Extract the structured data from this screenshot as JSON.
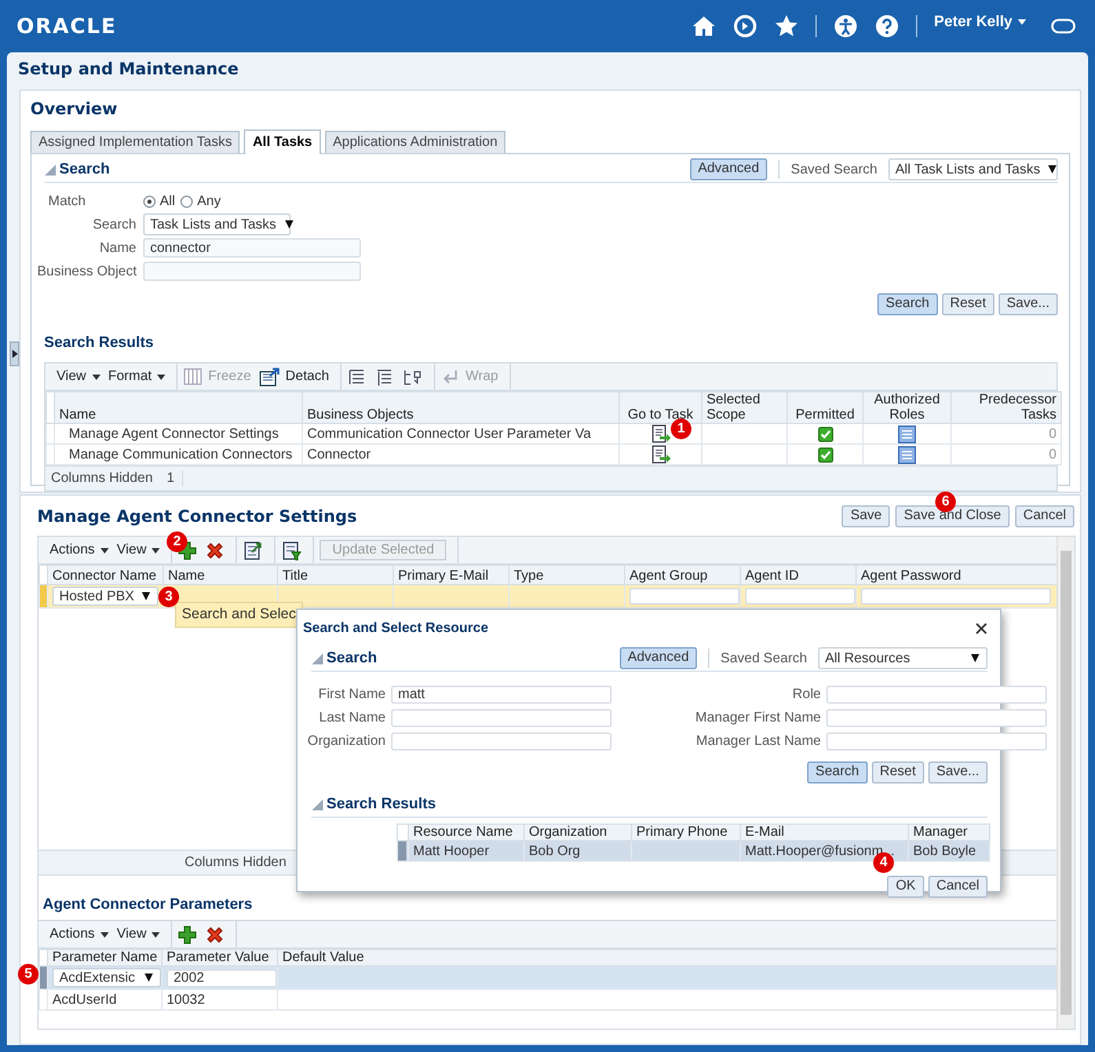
{
  "header": {
    "logo": "ORACLE",
    "user": "Peter Kelly"
  },
  "page_title": "Setup and Maintenance",
  "overview": {
    "title": "Overview",
    "tabs": [
      {
        "label": "Assigned Implementation Tasks",
        "selected": false
      },
      {
        "label": "All Tasks",
        "selected": true
      },
      {
        "label": "Applications Administration",
        "selected": false
      }
    ],
    "search": {
      "title": "Search",
      "advanced": "Advanced",
      "saved_search_label": "Saved Search",
      "saved_search": "All Task Lists and Tasks",
      "match": {
        "label": "Match",
        "options": [
          {
            "label": "All",
            "selected": true
          },
          {
            "label": "Any",
            "selected": false
          }
        ]
      },
      "fields": [
        {
          "label": "Search",
          "kind": "select",
          "value": "Task Lists and Tasks"
        },
        {
          "label": "Name",
          "kind": "text",
          "value": "connector"
        },
        {
          "label": "Business Object",
          "kind": "text"
        }
      ],
      "buttons": [
        {
          "label": "Search",
          "primary": true
        },
        {
          "label": "Reset",
          "primary": false
        },
        {
          "label": "Save...",
          "primary": false
        }
      ]
    },
    "results": {
      "title": "Search Results",
      "toolbar": [
        [
          {
            "kind": "menu",
            "label": "View",
            "disabled": false
          },
          {
            "kind": "menu",
            "label": "Format",
            "disabled": false
          }
        ],
        [
          {
            "kind": "freeze",
            "label": "Freeze",
            "disabled": true
          },
          {
            "kind": "detach",
            "label": "Detach",
            "disabled": false
          }
        ],
        [
          {
            "kind": "lines",
            "disabled": false
          },
          {
            "kind": "indent",
            "disabled": false
          },
          {
            "kind": "reorder",
            "disabled": false
          }
        ],
        [
          {
            "kind": "wrap",
            "label": "Wrap",
            "disabled": true
          }
        ]
      ],
      "columns": [
        "Name",
        "Business Objects",
        "Go to Task",
        "Selected Scope",
        "Permitted",
        "Authorized Roles",
        "Predecessor Tasks"
      ],
      "rows": [
        {
          "name": "Manage Agent Connector Settings",
          "business_objects": "Communication Connector User Parameter Va",
          "permitted": true,
          "predecessor_tasks": "0"
        },
        {
          "name": "Manage Communication Connectors",
          "business_objects": "Connector",
          "permitted": true,
          "predecessor_tasks": "0"
        }
      ],
      "columns_hidden_label": "Columns Hidden",
      "columns_hidden": "1"
    }
  },
  "settings": {
    "title": "Manage Agent Connector Settings",
    "buttons": [
      "Save",
      "Save and Close",
      "Cancel"
    ],
    "toolbar": [
      [
        {
          "kind": "menu",
          "label": "Actions",
          "disabled": false
        },
        {
          "kind": "menu",
          "label": "View",
          "disabled": false
        }
      ],
      [
        {
          "kind": "add",
          "disabled": false
        },
        {
          "kind": "delete",
          "disabled": false
        }
      ],
      [
        {
          "kind": "export",
          "disabled": false
        }
      ],
      [
        {
          "kind": "filter",
          "disabled": false
        }
      ],
      [
        {
          "kind": "text",
          "label": "Update Selected",
          "disabled": true
        }
      ]
    ],
    "columns": [
      "Connector Name",
      "Name",
      "Title",
      "Primary E-Mail",
      "Type",
      "Agent Group",
      "Agent ID",
      "Agent Password"
    ],
    "rows": [
      {
        "connector_name": "Hosted PBX",
        "selected": true
      }
    ],
    "columns_hidden_label": "Columns Hidden",
    "tooltip": "Search and Selec"
  },
  "parameters": {
    "title": "Agent Connector Parameters",
    "toolbar": [
      [
        {
          "kind": "menu",
          "label": "Actions",
          "disabled": false
        },
        {
          "kind": "menu",
          "label": "View",
          "disabled": false
        }
      ],
      [
        {
          "kind": "add",
          "disabled": false
        },
        {
          "kind": "delete",
          "disabled": false
        }
      ]
    ],
    "columns": [
      "Parameter Name",
      "Parameter Value",
      "Default Value"
    ],
    "rows": [
      {
        "name": "AcdExtensic",
        "value": "2002",
        "selected": true
      },
      {
        "name": "AcdUserId",
        "value": "10032",
        "selected": false
      }
    ]
  },
  "dialog": {
    "title": "Search and Select Resource",
    "search": {
      "title": "Search",
      "advanced": "Advanced",
      "saved_search_label": "Saved Search",
      "saved_search": "All Resources",
      "fields": [
        {
          "label": "First Name",
          "value": "matt"
        },
        {
          "label": "Role"
        },
        {
          "label": "Last Name"
        },
        {
          "label": "Manager First Name"
        },
        {
          "label": "Organization"
        },
        {
          "label": "Manager Last Name"
        }
      ],
      "buttons": [
        {
          "label": "Search",
          "primary": true
        },
        {
          "label": "Reset",
          "primary": false
        },
        {
          "label": "Save...",
          "primary": false
        }
      ]
    },
    "results": {
      "title": "Search Results",
      "columns": [
        "Resource Name",
        "Organization",
        "Primary Phone",
        "E-Mail",
        "Manager"
      ],
      "rows": [
        {
          "resource_name": "Matt Hooper",
          "organization": "Bob Org",
          "email": "Matt.Hooper@fusionm...",
          "manager": "Bob Boyle",
          "selected": true
        }
      ]
    },
    "buttons": [
      "OK",
      "Cancel"
    ]
  },
  "callouts": [
    "1",
    "2",
    "3",
    "4",
    "5",
    "6"
  ]
}
